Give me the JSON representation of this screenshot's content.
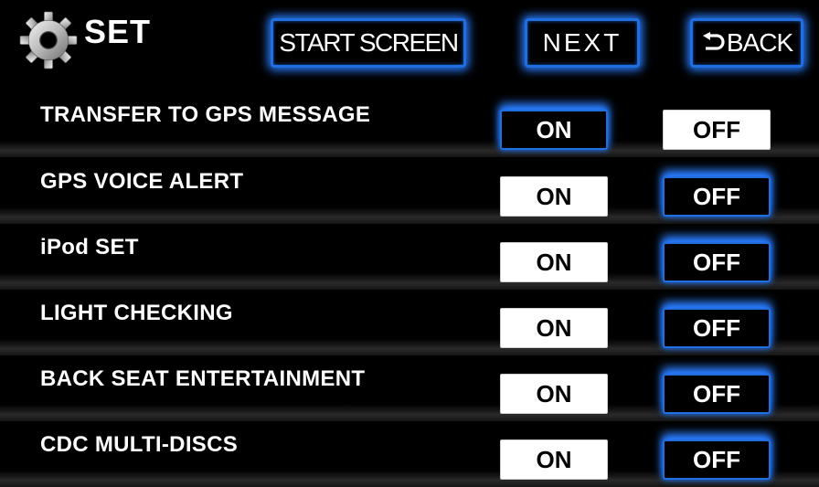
{
  "header": {
    "title": "SET",
    "icon": "gear-icon",
    "buttons": {
      "start_screen": "START SCREEN",
      "next": "NEXT",
      "back": "BACK"
    }
  },
  "colors": {
    "background": "#000000",
    "accent_glow": "#2a7dff",
    "active_text": "#ffffff",
    "inactive_bg": "#ffffff",
    "inactive_text": "#000000"
  },
  "settings": [
    {
      "label": "TRANSFER TO GPS MESSAGE",
      "on_label": "ON",
      "off_label": "OFF",
      "value": "ON"
    },
    {
      "label": "GPS VOICE ALERT",
      "on_label": "ON",
      "off_label": "OFF",
      "value": "OFF"
    },
    {
      "label": "iPod SET",
      "on_label": "ON",
      "off_label": "OFF",
      "value": "OFF"
    },
    {
      "label": "LIGHT CHECKING",
      "on_label": "ON",
      "off_label": "OFF",
      "value": "OFF"
    },
    {
      "label": "BACK SEAT ENTERTAINMENT",
      "on_label": "ON",
      "off_label": "OFF",
      "value": "OFF"
    },
    {
      "label": "CDC MULTI-DISCS",
      "on_label": "ON",
      "off_label": "OFF",
      "value": "OFF"
    }
  ]
}
